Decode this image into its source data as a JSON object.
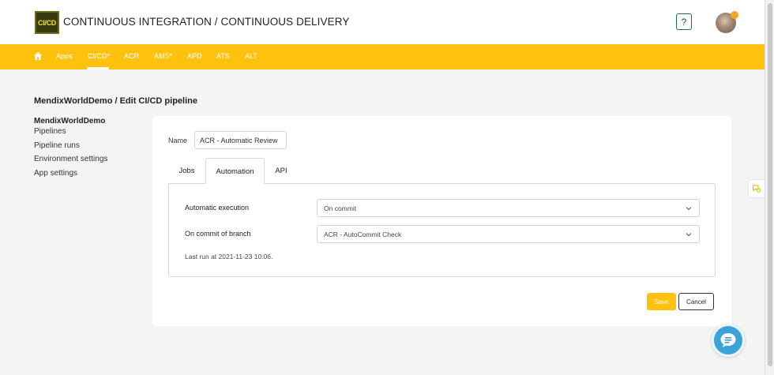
{
  "header": {
    "logo_text": "CI/CD",
    "title": "CONTINUOUS INTEGRATION / CONTINUOUS DELIVERY",
    "help_label": "?"
  },
  "nav": {
    "items": [
      {
        "label": "Apps"
      },
      {
        "label": "CI/CD*"
      },
      {
        "label": "ACR"
      },
      {
        "label": "AMS*"
      },
      {
        "label": "APD"
      },
      {
        "label": "ATS"
      },
      {
        "label": "ALT"
      }
    ],
    "active": "CI/CD*"
  },
  "page": {
    "title": "MendixWorldDemo / Edit CI/CD pipeline"
  },
  "sidebar": {
    "title": "MendixWorldDemo",
    "items": [
      {
        "label": "Pipelines"
      },
      {
        "label": "Pipeline runs"
      },
      {
        "label": "Environment settings"
      },
      {
        "label": "App settings"
      }
    ]
  },
  "form": {
    "name_label": "Name",
    "name_value": "ACR - Automatic Review",
    "tabs": [
      {
        "label": "Jobs"
      },
      {
        "label": "Automation"
      },
      {
        "label": "API"
      }
    ],
    "active_tab": "Automation",
    "automatic_execution_label": "Automatic execution",
    "automatic_execution_value": "On commit",
    "branch_label": "On commit of branch",
    "branch_value": "ACR - AutoCommit Check",
    "last_run": "Last run at 2021-11-23 10:06.",
    "save_label": "Save",
    "cancel_label": "Cancel"
  },
  "colors": {
    "accent": "#fdc10e",
    "chat": "#3aa4d8",
    "help_border": "#1d6a5a"
  },
  "icons": {
    "home": "home-icon",
    "chevron": "chevron-down-icon",
    "chat": "chat-icon",
    "feedback": "feedback-icon",
    "avatar": "avatar"
  }
}
